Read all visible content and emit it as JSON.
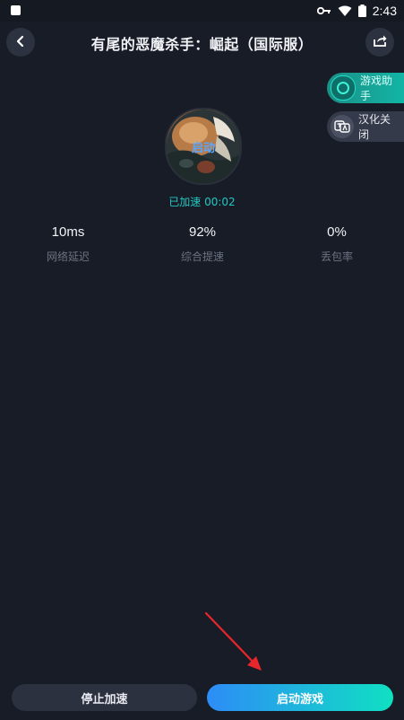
{
  "status_bar": {
    "time": "2:43"
  },
  "header": {
    "title": "有尾的恶魔杀手：崛起（国际服）"
  },
  "side_pills": {
    "assistant_label": "游戏助手",
    "translate_label": "汉化关闭"
  },
  "game": {
    "avatar_label": "启动",
    "status": "已加速 00:02"
  },
  "stats": [
    {
      "value": "10ms",
      "label": "网络延迟"
    },
    {
      "value": "92%",
      "label": "综合提速"
    },
    {
      "value": "0%",
      "label": "丢包率"
    }
  ],
  "buttons": {
    "stop_label": "停止加速",
    "start_label": "启动游戏"
  },
  "colors": {
    "background": "#181c26",
    "accent_teal": "#22c8c4",
    "accent_blue": "#2d8cf7",
    "annotation_arrow": "#e8262b"
  }
}
